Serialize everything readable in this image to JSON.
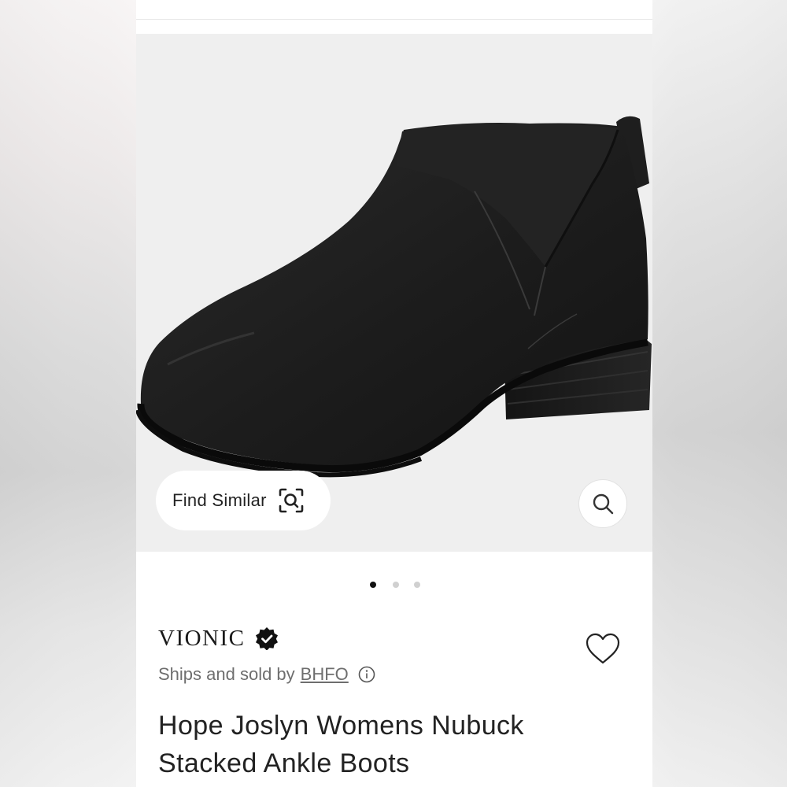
{
  "gallery": {
    "find_similar_label": "Find Similar",
    "active_index": 0,
    "image_count": 3
  },
  "product": {
    "brand": "VIONIC",
    "ships_prefix": "Ships and sold by",
    "seller": "BHFO",
    "title_line1": "Hope Joslyn Womens Nubuck",
    "title_line2": "Stacked Ankle Boots"
  },
  "icons": {
    "scan": "scan-search-icon",
    "zoom": "search-icon",
    "verified": "verified-badge-icon",
    "info": "info-icon",
    "wishlist": "heart-icon"
  },
  "colors": {
    "text": "#222222",
    "muted": "#6e6e6e",
    "dot_active": "#111111",
    "dot_inactive": "#d0d0d0",
    "image_bg": "#efefef"
  }
}
